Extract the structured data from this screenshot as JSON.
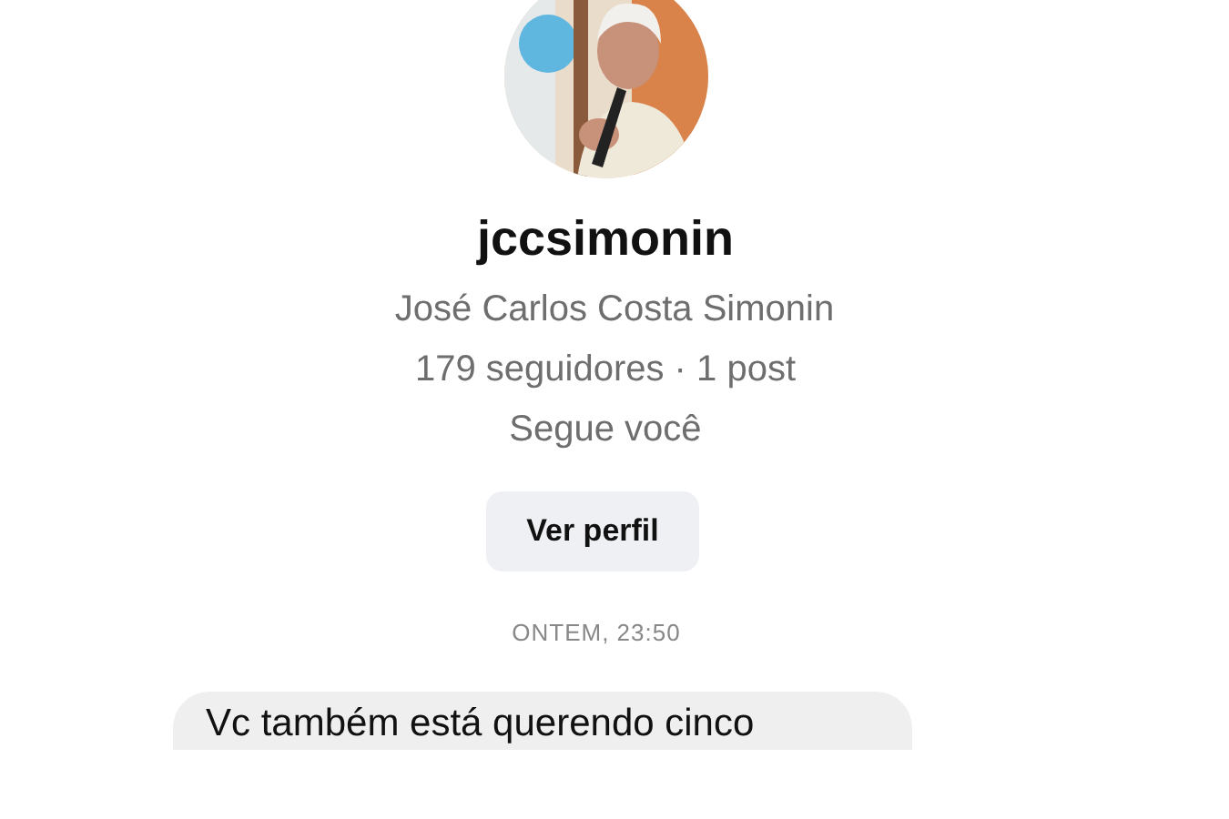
{
  "profile": {
    "username": "jccsimonin",
    "full_name": "José Carlos Costa Simonin",
    "stats": "179 seguidores · 1 post",
    "relation": "Segue você",
    "button": "Ver perfil"
  },
  "messages": [
    {
      "kind": "timestamp",
      "text": "ONTEM, 23:50"
    },
    {
      "kind": "received",
      "text": "Vc também está querendo cinco"
    }
  ]
}
